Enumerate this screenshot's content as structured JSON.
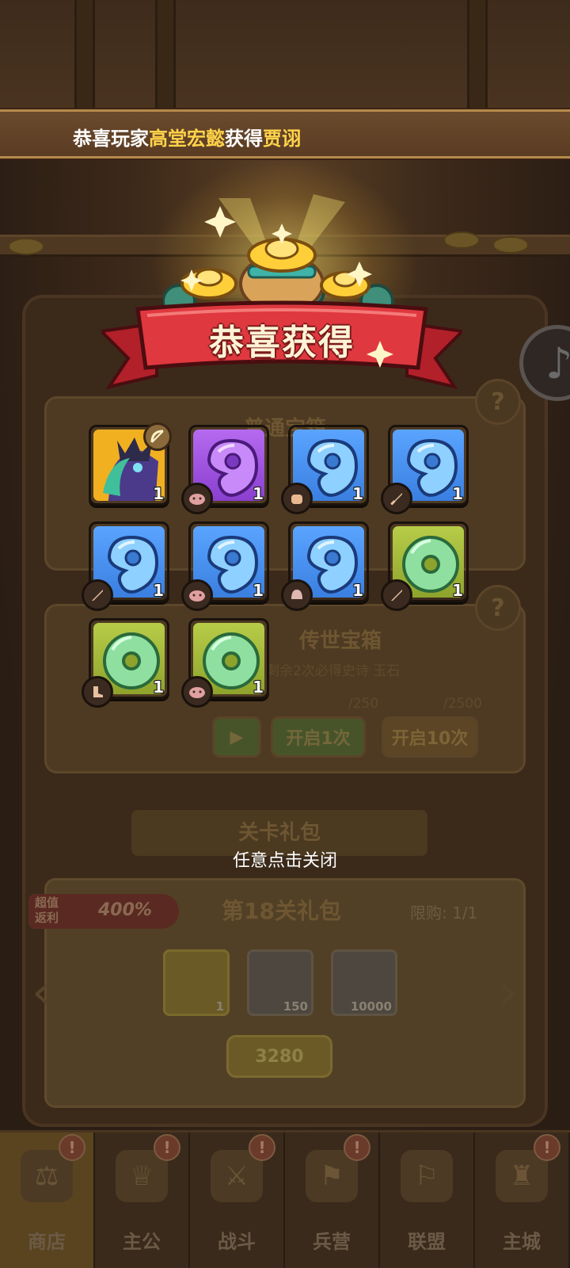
{
  "announcement": {
    "prefix": "恭喜玩家",
    "player": "高堂宏懿",
    "verb": "获得",
    "item": "贾诩"
  },
  "reward_popup": {
    "title": "恭喜获得",
    "close_hint": "任意点击关闭",
    "rewards": [
      {
        "kind": "hero-card",
        "rarity": "gold",
        "icon": "hero-portrait",
        "badge": "bow-icon",
        "qty": "1"
      },
      {
        "kind": "jade-gem",
        "rarity": "purple",
        "icon": "gem-icon",
        "badge": "pig-icon",
        "qty": "1"
      },
      {
        "kind": "jade-gem",
        "rarity": "blue",
        "icon": "gem-icon",
        "badge": "fist-icon",
        "qty": "1"
      },
      {
        "kind": "jade-gem",
        "rarity": "blue",
        "icon": "gem-icon",
        "badge": "sword-icon",
        "qty": "1"
      },
      {
        "kind": "jade-gem",
        "rarity": "blue",
        "icon": "gem-icon",
        "badge": "sword-icon",
        "qty": "1"
      },
      {
        "kind": "jade-gem",
        "rarity": "blue",
        "icon": "gem-icon",
        "badge": "pig-icon",
        "qty": "1"
      },
      {
        "kind": "jade-gem",
        "rarity": "blue",
        "icon": "gem-icon",
        "badge": "helmet-icon",
        "qty": "1"
      },
      {
        "kind": "jade-disc",
        "rarity": "green",
        "icon": "disc-icon",
        "badge": "sword-icon",
        "qty": "1"
      },
      {
        "kind": "jade-disc",
        "rarity": "green",
        "icon": "disc-icon",
        "badge": "boot-icon",
        "qty": "1"
      },
      {
        "kind": "jade-disc",
        "rarity": "green",
        "icon": "disc-icon",
        "badge": "pig-icon",
        "qty": "1"
      }
    ]
  },
  "background_shop": {
    "common_box_title": "普通宝箱",
    "legend_box": {
      "title": "传世宝箱",
      "guarantee_prefix": "剩余",
      "guarantee_count": "2",
      "guarantee_mid": "次必得",
      "guarantee_rarity": "史诗",
      "guarantee_item": "玉石",
      "cost_single": "/250",
      "cost_ten": "/2500",
      "open_once": "开启1次",
      "open_ten": "开启10次"
    },
    "stage_pack_header": "关卡礼包",
    "stage_pack": {
      "badge_line1": "超值",
      "badge_line2": "返利",
      "badge_percent": "400%",
      "title": "第18关礼包",
      "limit": "限购: 1/1",
      "items": [
        {
          "icon": "building-icon",
          "qty": "1"
        },
        {
          "icon": "stone-icon",
          "qty": "150"
        },
        {
          "icon": "coin-icon",
          "qty": "10000"
        }
      ],
      "price": "3280"
    }
  },
  "bottom_nav": [
    {
      "label": "商店",
      "icon": "shop-icon",
      "active": true,
      "alert": "!"
    },
    {
      "label": "主公",
      "icon": "lord-icon",
      "active": false,
      "alert": "!"
    },
    {
      "label": "战斗",
      "icon": "battle-icon",
      "active": false,
      "alert": "!"
    },
    {
      "label": "兵营",
      "icon": "barracks-icon",
      "active": false,
      "alert": "!"
    },
    {
      "label": "联盟",
      "icon": "alliance-icon",
      "active": false,
      "alert": ""
    },
    {
      "label": "主城",
      "icon": "city-icon",
      "active": false,
      "alert": "!"
    }
  ],
  "colors": {
    "banner_highlight": "#ffd34a",
    "ribbon_red": "#d8323a",
    "rarity_blue": "#3a7fe0",
    "rarity_purple": "#8a3fcf",
    "rarity_green": "#8ea32c",
    "rarity_gold": "#f0a818"
  }
}
